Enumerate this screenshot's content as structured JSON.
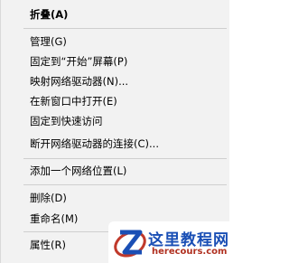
{
  "menu": {
    "items": [
      {
        "label": "折叠(A)"
      },
      {
        "label": "管理(G)"
      },
      {
        "label": "固定到“开始”屏幕(P)"
      },
      {
        "label": "映射网络驱动器(N)..."
      },
      {
        "label": "在新窗口中打开(E)"
      },
      {
        "label": "固定到快速访问"
      },
      {
        "label": "断开网络驱动器的连接(C)..."
      },
      {
        "label": "添加一个网络位置(L)"
      },
      {
        "label": "删除(D)"
      },
      {
        "label": "重命名(M)"
      },
      {
        "label": "属性(R)"
      }
    ]
  },
  "watermark": {
    "title": "这里教程网",
    "url": "herecours.com",
    "title_color": "#1a4fb5",
    "url_color": "#b03020"
  }
}
